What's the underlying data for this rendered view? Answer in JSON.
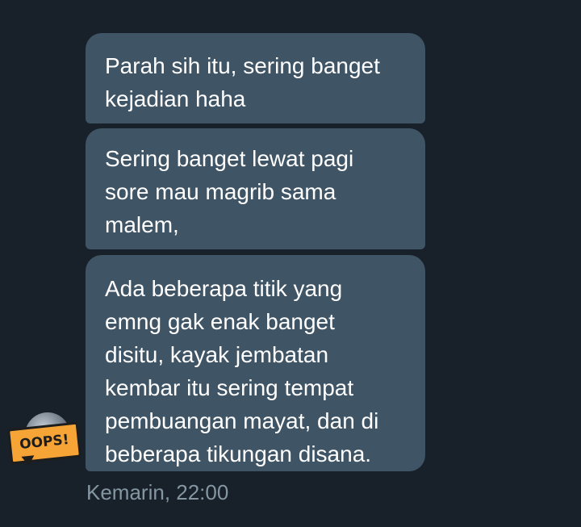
{
  "messages": [
    {
      "text": "Parah sih itu, sering banget\nkejadian haha"
    },
    {
      "text": "Sering banget lewat pagi\nsore mau magrib sama\nmalem,"
    },
    {
      "text": "Ada beberapa titik yang\nemng gak enak banget\ndisitu, kayak jembatan\nkembar itu sering tempat\npembuangan mayat, dan di\nbeberapa tikungan disana."
    }
  ],
  "timestamp": "Kemarin, 22:00",
  "avatar": {
    "sticker_text": "OOPS!",
    "icon": "avatar-sticker-icon"
  },
  "colors": {
    "background": "#18212a",
    "bubble": "#3f5465",
    "text": "#ffffff",
    "timestamp": "#8596a3",
    "sticker": "#f7a436"
  }
}
